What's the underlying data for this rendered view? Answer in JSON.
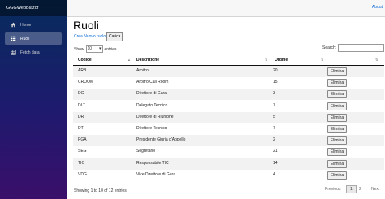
{
  "app_title": "GGGWebBlazor",
  "about_link": "About",
  "nav": [
    {
      "label": "Home",
      "icon": "home-icon"
    },
    {
      "label": "Ruoli",
      "icon": "list-icon"
    },
    {
      "label": "Fetch data",
      "icon": "table-icon"
    }
  ],
  "page_title": "Ruoli",
  "create_link": "Crea Nuovo ruolo",
  "carica_label": "Carica",
  "show_label": "Show",
  "entries_value": "10",
  "entries_label": "entries",
  "search_label": "Search:",
  "columns": [
    "Codice",
    "Descrizione",
    "Ordine"
  ],
  "rows": [
    {
      "codice": "ARB",
      "descrizione": "Arbitro",
      "ordine": "20"
    },
    {
      "codice": "CROOM",
      "descrizione": "Arbitro Call Room",
      "ordine": "15"
    },
    {
      "codice": "DG",
      "descrizione": "Direttore di Gara",
      "ordine": "3"
    },
    {
      "codice": "DLT",
      "descrizione": "Delegato Tecnico",
      "ordine": "7"
    },
    {
      "codice": "DR",
      "descrizione": "Direttore di Riunione",
      "ordine": "5"
    },
    {
      "codice": "DT",
      "descrizione": "Direttore Tecnico",
      "ordine": "7"
    },
    {
      "codice": "PGA",
      "descrizione": "Presidente Giuria d'Appello",
      "ordine": "2"
    },
    {
      "codice": "SEG",
      "descrizione": "Segretario",
      "ordine": "21"
    },
    {
      "codice": "TIC",
      "descrizione": "Responsabile TIC",
      "ordine": "14"
    },
    {
      "codice": "VDG",
      "descrizione": "Vice Direttore di Gara",
      "ordine": "4"
    }
  ],
  "elimina_label": "Elimina",
  "info_text": "Showing 1 to 10 of 12 entries",
  "pagination": {
    "previous": "Previous",
    "pages": [
      "1",
      "2"
    ],
    "next": "Next"
  }
}
